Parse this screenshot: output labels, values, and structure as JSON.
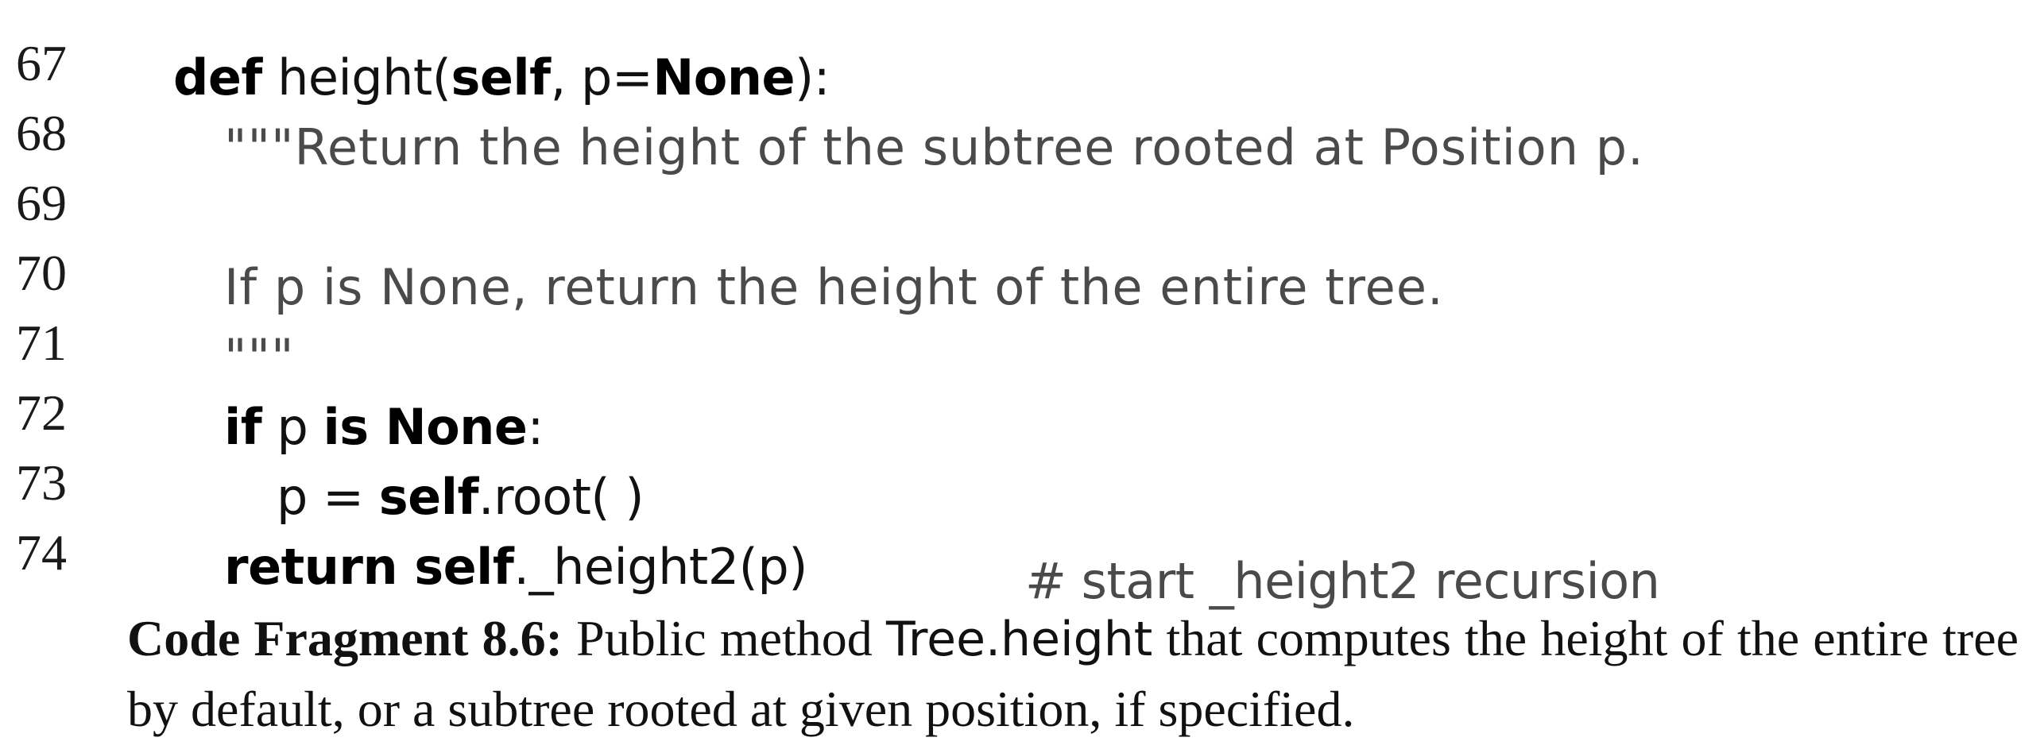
{
  "code": {
    "lines": [
      {
        "number": "67",
        "parts": [
          "def",
          " height(",
          "self",
          ", p=",
          "None",
          "):"
        ]
      },
      {
        "number": "68",
        "parts": [
          "\"\"\"Return the height of the subtree rooted at Position p."
        ]
      },
      {
        "number": "69",
        "parts": [
          ""
        ]
      },
      {
        "number": "70",
        "parts": [
          "If p is None, return the height of the entire tree."
        ]
      },
      {
        "number": "71",
        "parts": [
          "\"\"\""
        ]
      },
      {
        "number": "72",
        "parts": [
          "if",
          " p ",
          "is None",
          ":"
        ]
      },
      {
        "number": "73",
        "parts": [
          "p = ",
          "self",
          ".root( )"
        ]
      },
      {
        "number": "74",
        "parts": [
          "return self",
          "._height2(p)"
        ],
        "comment": "# start _height2 recursion"
      }
    ]
  },
  "caption": {
    "label": "Code Fragment 8.6:",
    "text_before": "Public method",
    "identifier": "Tree.height",
    "text_after": "that computes the height of the entire tree by default, or a subtree rooted at given position, if specified."
  }
}
